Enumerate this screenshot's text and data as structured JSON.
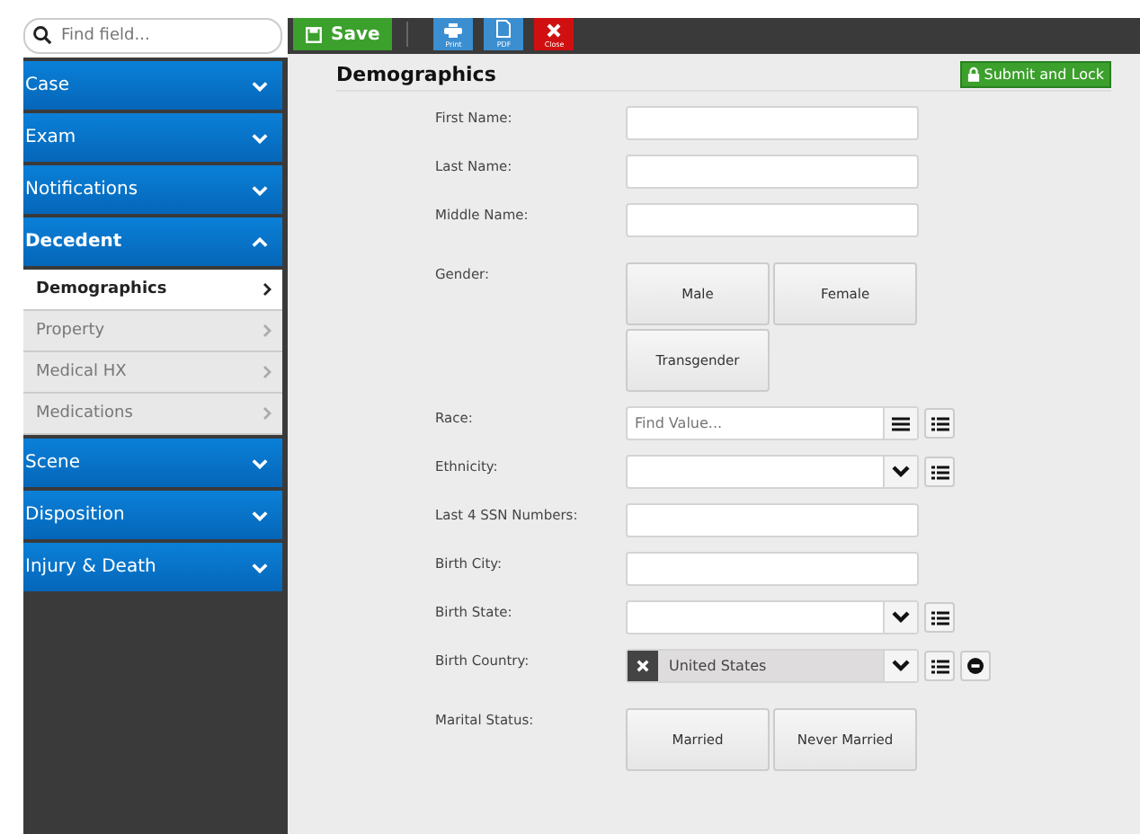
{
  "search": {
    "placeholder": "Find field..."
  },
  "toolbar": {
    "save": "Save",
    "buttons": [
      {
        "kind": "print",
        "label": "Print"
      },
      {
        "kind": "pdf",
        "label": "PDF"
      },
      {
        "kind": "close",
        "label": "Close"
      }
    ]
  },
  "sidebar": {
    "sections": [
      {
        "label": "Case",
        "expanded": false
      },
      {
        "label": "Exam",
        "expanded": false
      },
      {
        "label": "Notifications",
        "expanded": false
      },
      {
        "label": "Decedent",
        "expanded": true,
        "items": [
          {
            "label": "Demographics",
            "selected": true
          },
          {
            "label": "Property",
            "selected": false
          },
          {
            "label": "Medical HX",
            "selected": false
          },
          {
            "label": "Medications",
            "selected": false
          }
        ]
      },
      {
        "label": "Scene",
        "expanded": false
      },
      {
        "label": "Disposition",
        "expanded": false
      },
      {
        "label": "Injury & Death",
        "expanded": false
      }
    ]
  },
  "form": {
    "title": "Demographics",
    "submit": "Submit and Lock",
    "fields": [
      {
        "kind": "text",
        "label": "First Name:"
      },
      {
        "kind": "text",
        "label": "Last Name:"
      },
      {
        "kind": "text",
        "label": "Middle Name:"
      },
      {
        "kind": "choice",
        "label": "Gender:",
        "options": [
          "Male",
          "Female",
          "Transgender"
        ]
      },
      {
        "kind": "lookup",
        "label": "Race:",
        "placeholder": "Find Value..."
      },
      {
        "kind": "select",
        "label": "Ethnicity:"
      },
      {
        "kind": "text",
        "label": "Last 4 SSN Numbers:"
      },
      {
        "kind": "text",
        "label": "Birth City:"
      },
      {
        "kind": "select",
        "label": "Birth State:"
      },
      {
        "kind": "country",
        "label": "Birth Country:",
        "value": "United States"
      },
      {
        "kind": "choice",
        "label": "Marital Status:",
        "options": [
          "Married",
          "Never Married"
        ]
      }
    ]
  }
}
